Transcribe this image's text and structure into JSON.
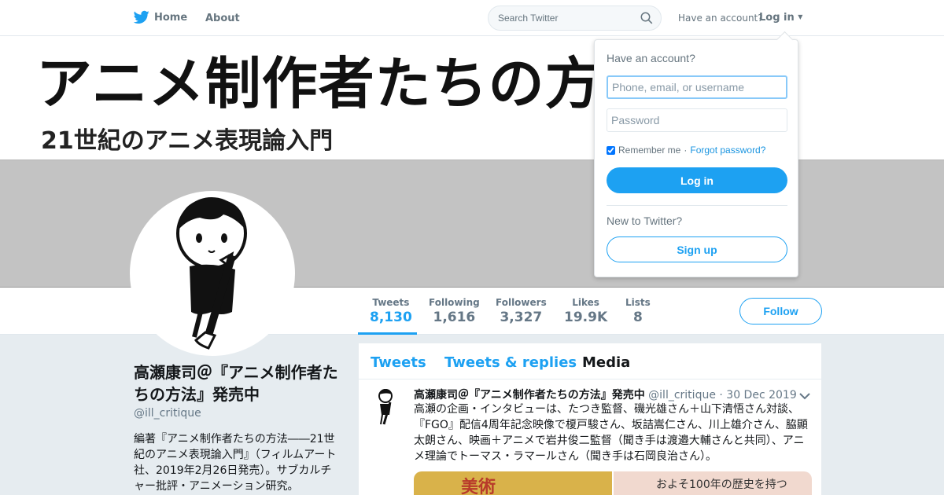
{
  "nav": {
    "home_label": "Home",
    "about_label": "About",
    "search_placeholder": "Search Twitter",
    "have_account": "Have an account?",
    "login_label": "Log in"
  },
  "banner": {
    "title": "アニメ制作者たちの方法",
    "subtitle": "21世紀のアニメ表現論入門"
  },
  "stats": [
    {
      "label": "Tweets",
      "value": "8,130"
    },
    {
      "label": "Following",
      "value": "1,616"
    },
    {
      "label": "Followers",
      "value": "3,327"
    },
    {
      "label": "Likes",
      "value": "19.9K"
    },
    {
      "label": "Lists",
      "value": "8"
    }
  ],
  "follow_label": "Follow",
  "profile": {
    "name": "高瀬康司＠『アニメ制作者たちの方法』発売中",
    "handle": "@ill_critique",
    "bio": "編著『アニメ制作者たちの方法――21世紀のアニメ表現論入門』（フィルムアート社、2019年2月26日発売）。サブカルチャー批評・アニメーション研究。"
  },
  "timeline": {
    "tabs": [
      "Tweets",
      "Tweets & replies",
      "Media"
    ],
    "tweet": {
      "author": "高瀬康司＠『アニメ制作者たちの方法』発売中",
      "handle": "@ill_critique",
      "time": "· 30 Dec 2019",
      "text": "高瀬の企画・インタビューは、たつき監督、磯光雄さん＋山下清悟さん対談、『FGO』配信4周年記念映像で榎戸駿さん、坂詰嵩仁さん、川上雄介さん、脇顯太朗さん、映画＋アニメで岩井俊二監督（聞き手は渡邉大輔さんと共同）、アニメ理論でトーマス・ラマールさん（聞き手は石岡良治さん）。",
      "media1_text": "美術",
      "media2_text": "およそ100年の歴史を持つ"
    }
  },
  "login_dropdown": {
    "title": "Have an account?",
    "username_placeholder": "Phone, email, or username",
    "password_placeholder": "Password",
    "remember": "Remember me",
    "separator": "·",
    "forgot": "Forgot password?",
    "login_button": "Log in",
    "new_label": "New to Twitter?",
    "signup_button": "Sign up"
  },
  "colors": {
    "accent": "#1da1f2",
    "background": "#e6ecf0"
  }
}
